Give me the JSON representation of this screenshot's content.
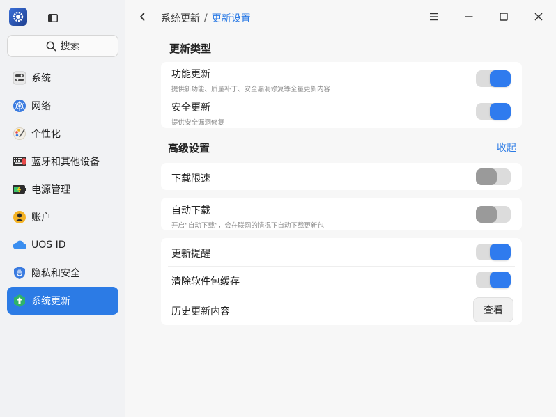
{
  "sidebar": {
    "search_label": "搜索",
    "items": [
      {
        "label": "系统",
        "icon": "system-icon"
      },
      {
        "label": "网络",
        "icon": "network-icon"
      },
      {
        "label": "个性化",
        "icon": "personalization-icon"
      },
      {
        "label": "蓝牙和其他设备",
        "icon": "bluetooth-devices-icon"
      },
      {
        "label": "电源管理",
        "icon": "power-icon"
      },
      {
        "label": "账户",
        "icon": "account-icon"
      },
      {
        "label": "UOS ID",
        "icon": "cloud-icon"
      },
      {
        "label": "隐私和安全",
        "icon": "privacy-shield-icon"
      },
      {
        "label": "系统更新",
        "icon": "update-icon",
        "active": true
      }
    ]
  },
  "header": {
    "breadcrumb_parent": "系统更新",
    "breadcrumb_separator": "/",
    "breadcrumb_current": "更新设置"
  },
  "update_type": {
    "title": "更新类型",
    "rows": [
      {
        "title": "功能更新",
        "desc": "提供新功能、质量补丁、安全漏洞修复等全量更新内容",
        "enabled": true
      },
      {
        "title": "安全更新",
        "desc": "提供安全漏洞修复",
        "enabled": true
      }
    ]
  },
  "advanced": {
    "title": "高级设置",
    "collapse_label": "收起",
    "download_limit": {
      "title": "下载限速",
      "enabled": false
    },
    "auto_download": {
      "title": "自动下载",
      "desc": "开启“自动下载”，会在联网的情况下自动下载更新包",
      "enabled": false
    },
    "update_reminder": {
      "title": "更新提醒",
      "enabled": true
    },
    "clear_cache": {
      "title": "清除软件包缓存",
      "enabled": true
    },
    "history": {
      "title": "历史更新内容",
      "button_label": "查看"
    }
  },
  "colors": {
    "accent": "#2c7be5",
    "toggle_on": "#2f7bee",
    "toggle_off": "#9a9a9a"
  }
}
